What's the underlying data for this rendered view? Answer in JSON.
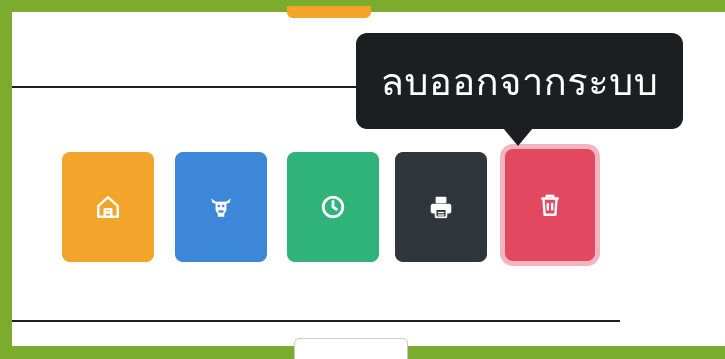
{
  "tooltip": {
    "text": "ลบออกจากระบบ"
  },
  "actions": [
    {
      "icon": "home-icon",
      "color": "#f2a42b"
    },
    {
      "icon": "cow-icon",
      "color": "#3d87d9"
    },
    {
      "icon": "clock-icon",
      "color": "#2fb37a"
    },
    {
      "icon": "printer-icon",
      "color": "#30353b"
    },
    {
      "icon": "trash-icon",
      "color": "#e24860"
    }
  ],
  "colors": {
    "frame": "#7bac2e",
    "panel": "#ffffff"
  }
}
